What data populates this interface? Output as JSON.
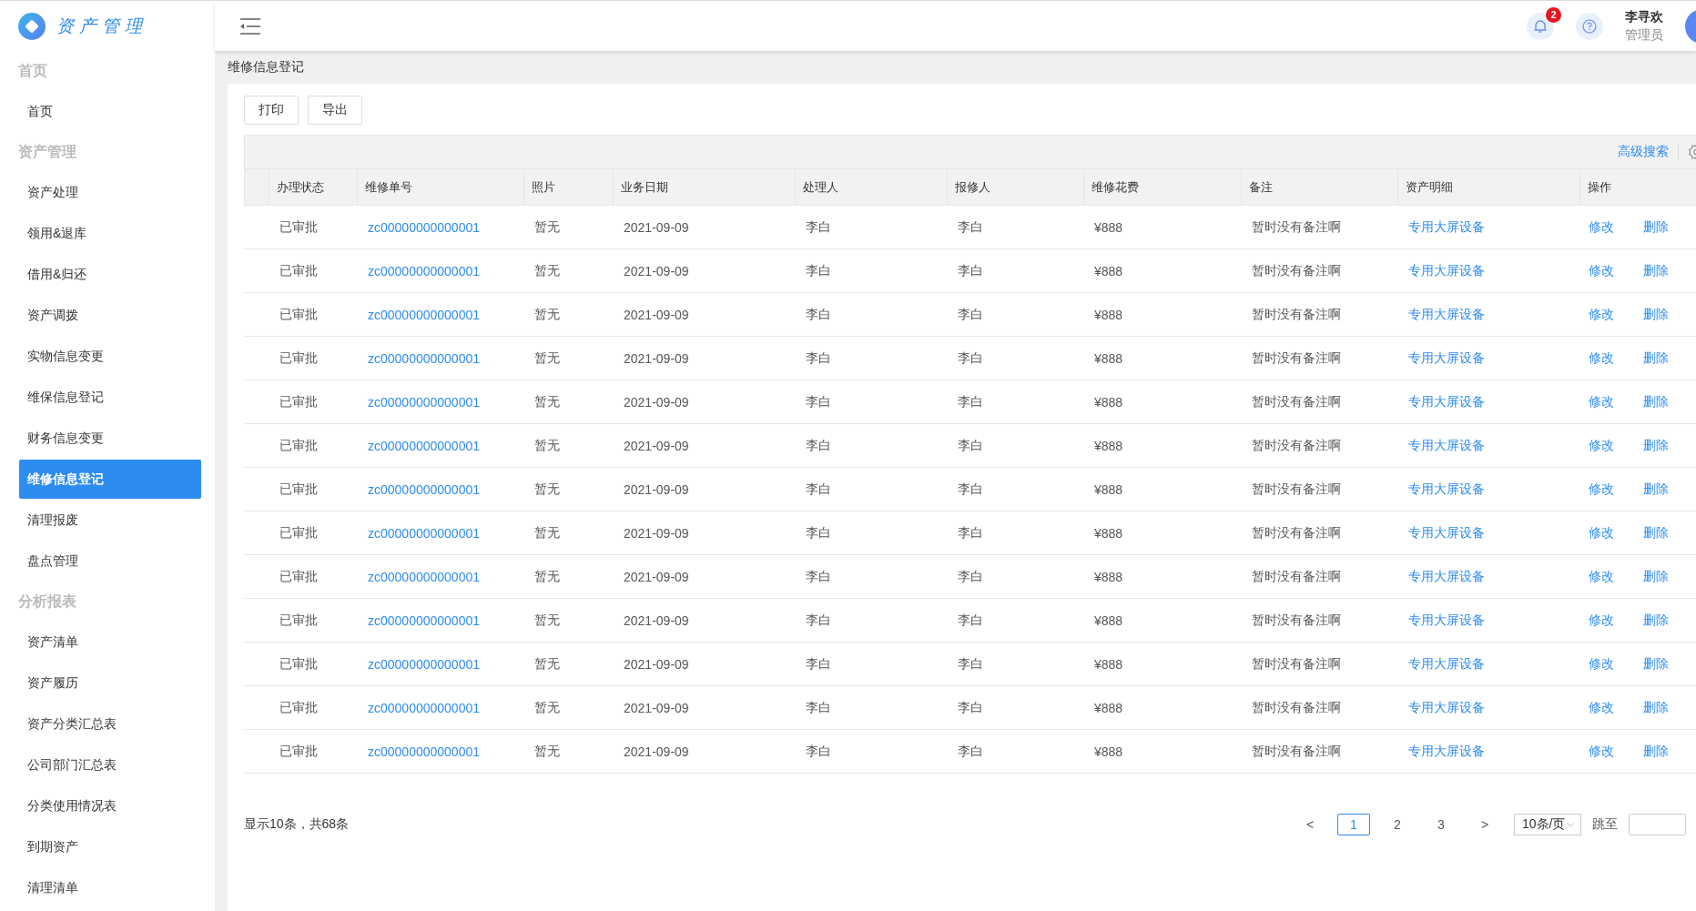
{
  "app": {
    "logo_text": "资产管理"
  },
  "header": {
    "notification_count": "2",
    "user_name": "李寻欢",
    "user_role": "管理员"
  },
  "sidebar": {
    "groups": [
      {
        "title": "首页",
        "items": [
          {
            "label": "首页",
            "selected": false
          }
        ]
      },
      {
        "title": "资产管理",
        "items": [
          {
            "label": "资产处理",
            "selected": false
          },
          {
            "label": "领用&退库",
            "selected": false
          },
          {
            "label": "借用&归还",
            "selected": false
          },
          {
            "label": "资产调拨",
            "selected": false
          },
          {
            "label": "实物信息变更",
            "selected": false
          },
          {
            "label": "维保信息登记",
            "selected": false
          },
          {
            "label": "财务信息变更",
            "selected": false
          },
          {
            "label": "维修信息登记",
            "selected": true
          },
          {
            "label": "清理报废",
            "selected": false
          },
          {
            "label": "盘点管理",
            "selected": false
          }
        ]
      },
      {
        "title": "分析报表",
        "items": [
          {
            "label": "资产清单",
            "selected": false
          },
          {
            "label": "资产履历",
            "selected": false
          },
          {
            "label": "资产分类汇总表",
            "selected": false
          },
          {
            "label": "公司部门汇总表",
            "selected": false
          },
          {
            "label": "分类使用情况表",
            "selected": false
          },
          {
            "label": "到期资产",
            "selected": false
          },
          {
            "label": "清理清单",
            "selected": false
          }
        ]
      }
    ]
  },
  "breadcrumb": "维修信息登记",
  "buttons": [
    "打印",
    "导出"
  ],
  "table": {
    "advanced_search": "高级搜索",
    "columns": [
      {
        "label": "办理状态",
        "kind": "text"
      },
      {
        "label": "维修单号",
        "kind": "link"
      },
      {
        "label": "照片",
        "kind": "text"
      },
      {
        "label": "业务日期",
        "kind": "text"
      },
      {
        "label": "处理人",
        "kind": "text"
      },
      {
        "label": "报修人",
        "kind": "text"
      },
      {
        "label": "维修花费",
        "kind": "text"
      },
      {
        "label": "备注",
        "kind": "text"
      },
      {
        "label": "资产明细",
        "kind": "link"
      },
      {
        "label": "操作",
        "kind": "actions"
      }
    ],
    "rows": [
      {
        "cells": [
          "已审批",
          "zc00000000000001",
          "暂无",
          "2021-09-09",
          "李白",
          "李白",
          "¥888",
          "暂时没有备注啊",
          "专用大屏设备"
        ],
        "actions": [
          "修改",
          "删除"
        ]
      },
      {
        "cells": [
          "已审批",
          "zc00000000000001",
          "暂无",
          "2021-09-09",
          "李白",
          "李白",
          "¥888",
          "暂时没有备注啊",
          "专用大屏设备"
        ],
        "actions": [
          "修改",
          "删除"
        ]
      },
      {
        "cells": [
          "已审批",
          "zc00000000000001",
          "暂无",
          "2021-09-09",
          "李白",
          "李白",
          "¥888",
          "暂时没有备注啊",
          "专用大屏设备"
        ],
        "actions": [
          "修改",
          "删除"
        ]
      },
      {
        "cells": [
          "已审批",
          "zc00000000000001",
          "暂无",
          "2021-09-09",
          "李白",
          "李白",
          "¥888",
          "暂时没有备注啊",
          "专用大屏设备"
        ],
        "actions": [
          "修改",
          "删除"
        ]
      },
      {
        "cells": [
          "已审批",
          "zc00000000000001",
          "暂无",
          "2021-09-09",
          "李白",
          "李白",
          "¥888",
          "暂时没有备注啊",
          "专用大屏设备"
        ],
        "actions": [
          "修改",
          "删除"
        ]
      },
      {
        "cells": [
          "已审批",
          "zc00000000000001",
          "暂无",
          "2021-09-09",
          "李白",
          "李白",
          "¥888",
          "暂时没有备注啊",
          "专用大屏设备"
        ],
        "actions": [
          "修改",
          "删除"
        ]
      },
      {
        "cells": [
          "已审批",
          "zc00000000000001",
          "暂无",
          "2021-09-09",
          "李白",
          "李白",
          "¥888",
          "暂时没有备注啊",
          "专用大屏设备"
        ],
        "actions": [
          "修改",
          "删除"
        ]
      },
      {
        "cells": [
          "已审批",
          "zc00000000000001",
          "暂无",
          "2021-09-09",
          "李白",
          "李白",
          "¥888",
          "暂时没有备注啊",
          "专用大屏设备"
        ],
        "actions": [
          "修改",
          "删除"
        ]
      },
      {
        "cells": [
          "已审批",
          "zc00000000000001",
          "暂无",
          "2021-09-09",
          "李白",
          "李白",
          "¥888",
          "暂时没有备注啊",
          "专用大屏设备"
        ],
        "actions": [
          "修改",
          "删除"
        ]
      },
      {
        "cells": [
          "已审批",
          "zc00000000000001",
          "暂无",
          "2021-09-09",
          "李白",
          "李白",
          "¥888",
          "暂时没有备注啊",
          "专用大屏设备"
        ],
        "actions": [
          "修改",
          "删除"
        ]
      },
      {
        "cells": [
          "已审批",
          "zc00000000000001",
          "暂无",
          "2021-09-09",
          "李白",
          "李白",
          "¥888",
          "暂时没有备注啊",
          "专用大屏设备"
        ],
        "actions": [
          "修改",
          "删除"
        ]
      },
      {
        "cells": [
          "已审批",
          "zc00000000000001",
          "暂无",
          "2021-09-09",
          "李白",
          "李白",
          "¥888",
          "暂时没有备注啊",
          "专用大屏设备"
        ],
        "actions": [
          "修改",
          "删除"
        ]
      },
      {
        "cells": [
          "已审批",
          "zc00000000000001",
          "暂无",
          "2021-09-09",
          "李白",
          "李白",
          "¥888",
          "暂时没有备注啊",
          "专用大屏设备"
        ],
        "actions": [
          "修改",
          "删除"
        ]
      }
    ]
  },
  "pagination": {
    "summary": "显示10条，共68条",
    "prev": "<",
    "pages": [
      {
        "label": "1",
        "selected": true
      },
      {
        "label": "2",
        "selected": false
      },
      {
        "label": "3",
        "selected": false
      }
    ],
    "next": ">",
    "page_size": "10条/页",
    "jump_label": "跳至"
  }
}
